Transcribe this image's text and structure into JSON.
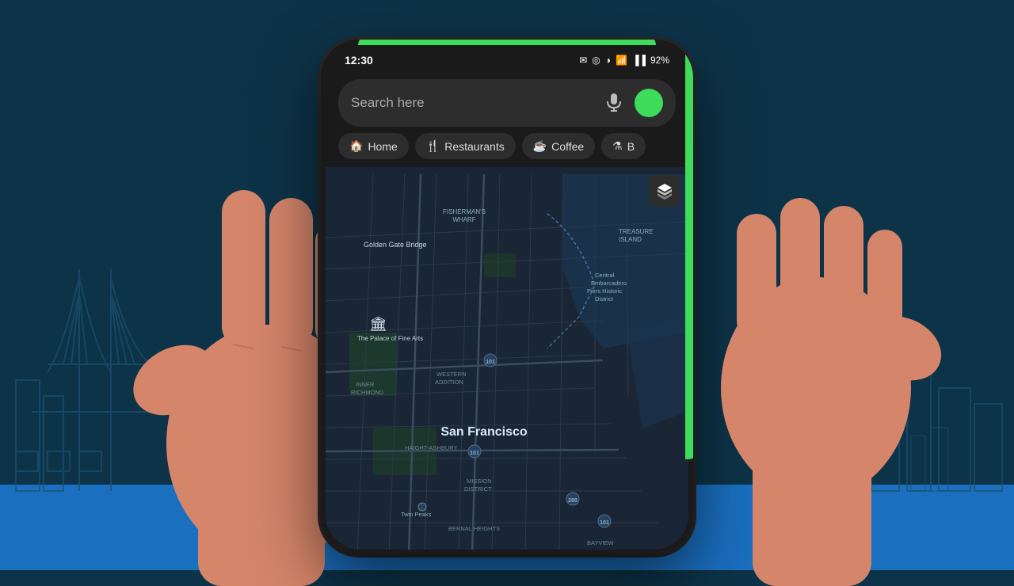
{
  "background": {
    "color": "#0d3348",
    "water_color": "#1a6fbf"
  },
  "moon": {
    "color": "#e8601a"
  },
  "phone": {
    "status_bar": {
      "time": "12:30",
      "battery": "92%",
      "icons": [
        "message",
        "location",
        "brightness",
        "wifi",
        "signal"
      ]
    },
    "search": {
      "placeholder": "Search here",
      "mic_label": "mic",
      "profile_dot_color": "#3ddc5a"
    },
    "chips": [
      {
        "icon": "🏠",
        "label": "Home"
      },
      {
        "icon": "🍴",
        "label": "Restaurants"
      },
      {
        "icon": "☕",
        "label": "Coffee"
      },
      {
        "icon": "🍺",
        "label": "B"
      }
    ],
    "map": {
      "city_label": "San Francisco",
      "neighborhoods": [
        "Golden Gate Bridge",
        "FISHERMAN'S WHARF",
        "The Palace of Fine Arts",
        "INNER RICHMOND",
        "WESTERN ADDITION",
        "HAIGHT-ASHBURY",
        "MISSION DISTRICT",
        "BERNAL HEIGHTS",
        "BAYVIEW",
        "Central Embarcadero Piers Historic District",
        "TREASURE ISLAND",
        "Twin Peaks"
      ]
    }
  },
  "detected": {
    "coffee_text": "2 Coffee",
    "search_text": "Search here"
  }
}
